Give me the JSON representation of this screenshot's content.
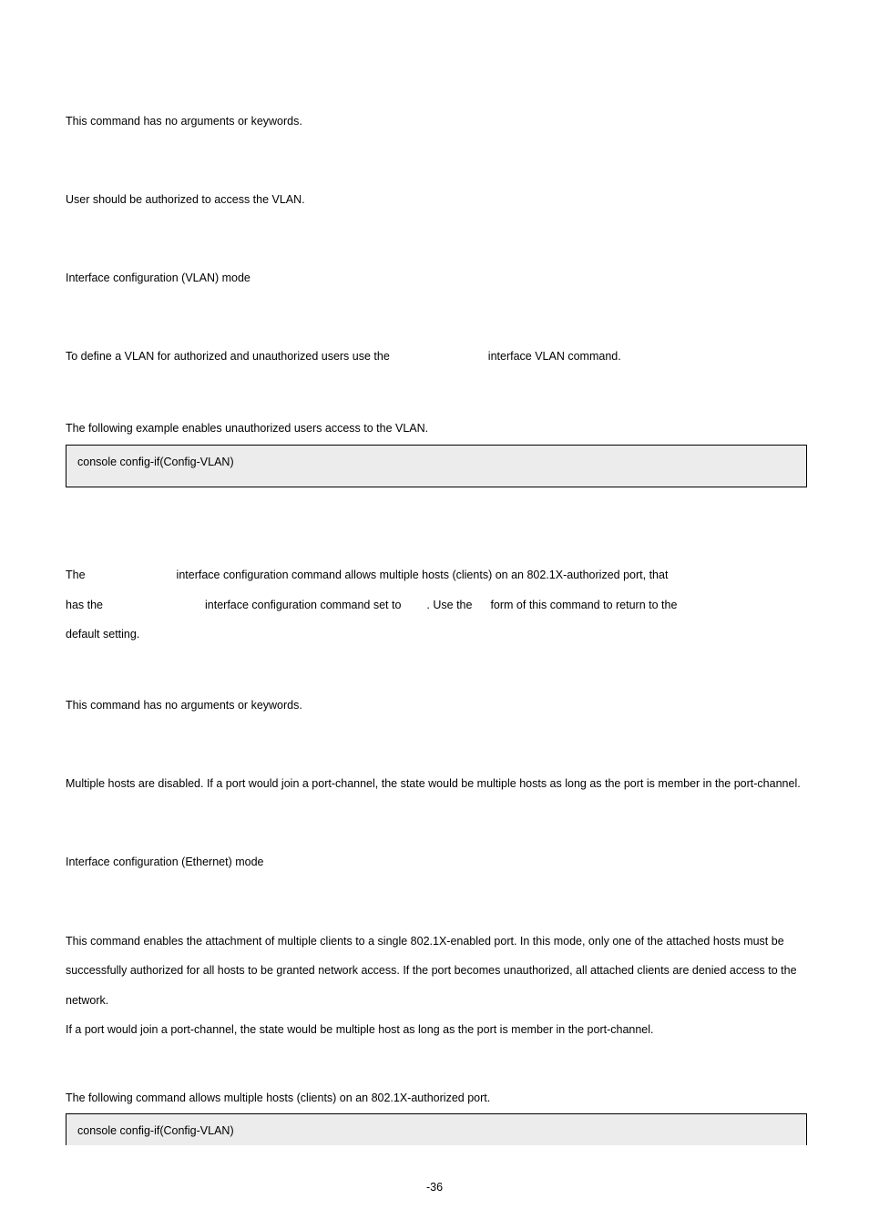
{
  "section1": {
    "syntax": "This command has no arguments or keywords.",
    "default": "User should be authorized to access the VLAN.",
    "mode": "Interface configuration (VLAN) mode",
    "guideline_pre": "To define a VLAN for authorized and unauthorized users use the",
    "guideline_post": "interface VLAN command.",
    "example_intro": "The following example enables unauthorized users access to the VLAN.",
    "example_code": "console config-if(Config-VLAN)"
  },
  "section2": {
    "desc": {
      "p1a": "The",
      "p1b": "interface configuration command allows multiple hosts (clients) on an 802.1X-authorized port, that",
      "p2a": "has the",
      "p2b": "interface configuration command set to",
      "p2c": ". Use the",
      "p2d": "form of this command to return to the",
      "p3": "default setting."
    },
    "syntax": "This command has no arguments or keywords.",
    "default": "Multiple hosts are disabled. If a port would join a port-channel, the state would be multiple hosts as long as the port is member in the port-channel.",
    "mode": "Interface configuration (Ethernet) mode",
    "guidelines_p1": "This command enables the attachment of multiple clients to a single 802.1X-enabled port. In this mode, only one of the attached hosts must be successfully authorized for all hosts to be granted network access. If the port becomes unauthorized, all attached clients are denied access to the network.",
    "guidelines_p2": "If a port would join a port-channel, the state would be multiple host as long as the port is member in the port-channel.",
    "example_intro": "The following command allows multiple hosts (clients) on an 802.1X-authorized port.",
    "example_code": "console config-if(Config-VLAN)"
  },
  "page_number": "-36"
}
